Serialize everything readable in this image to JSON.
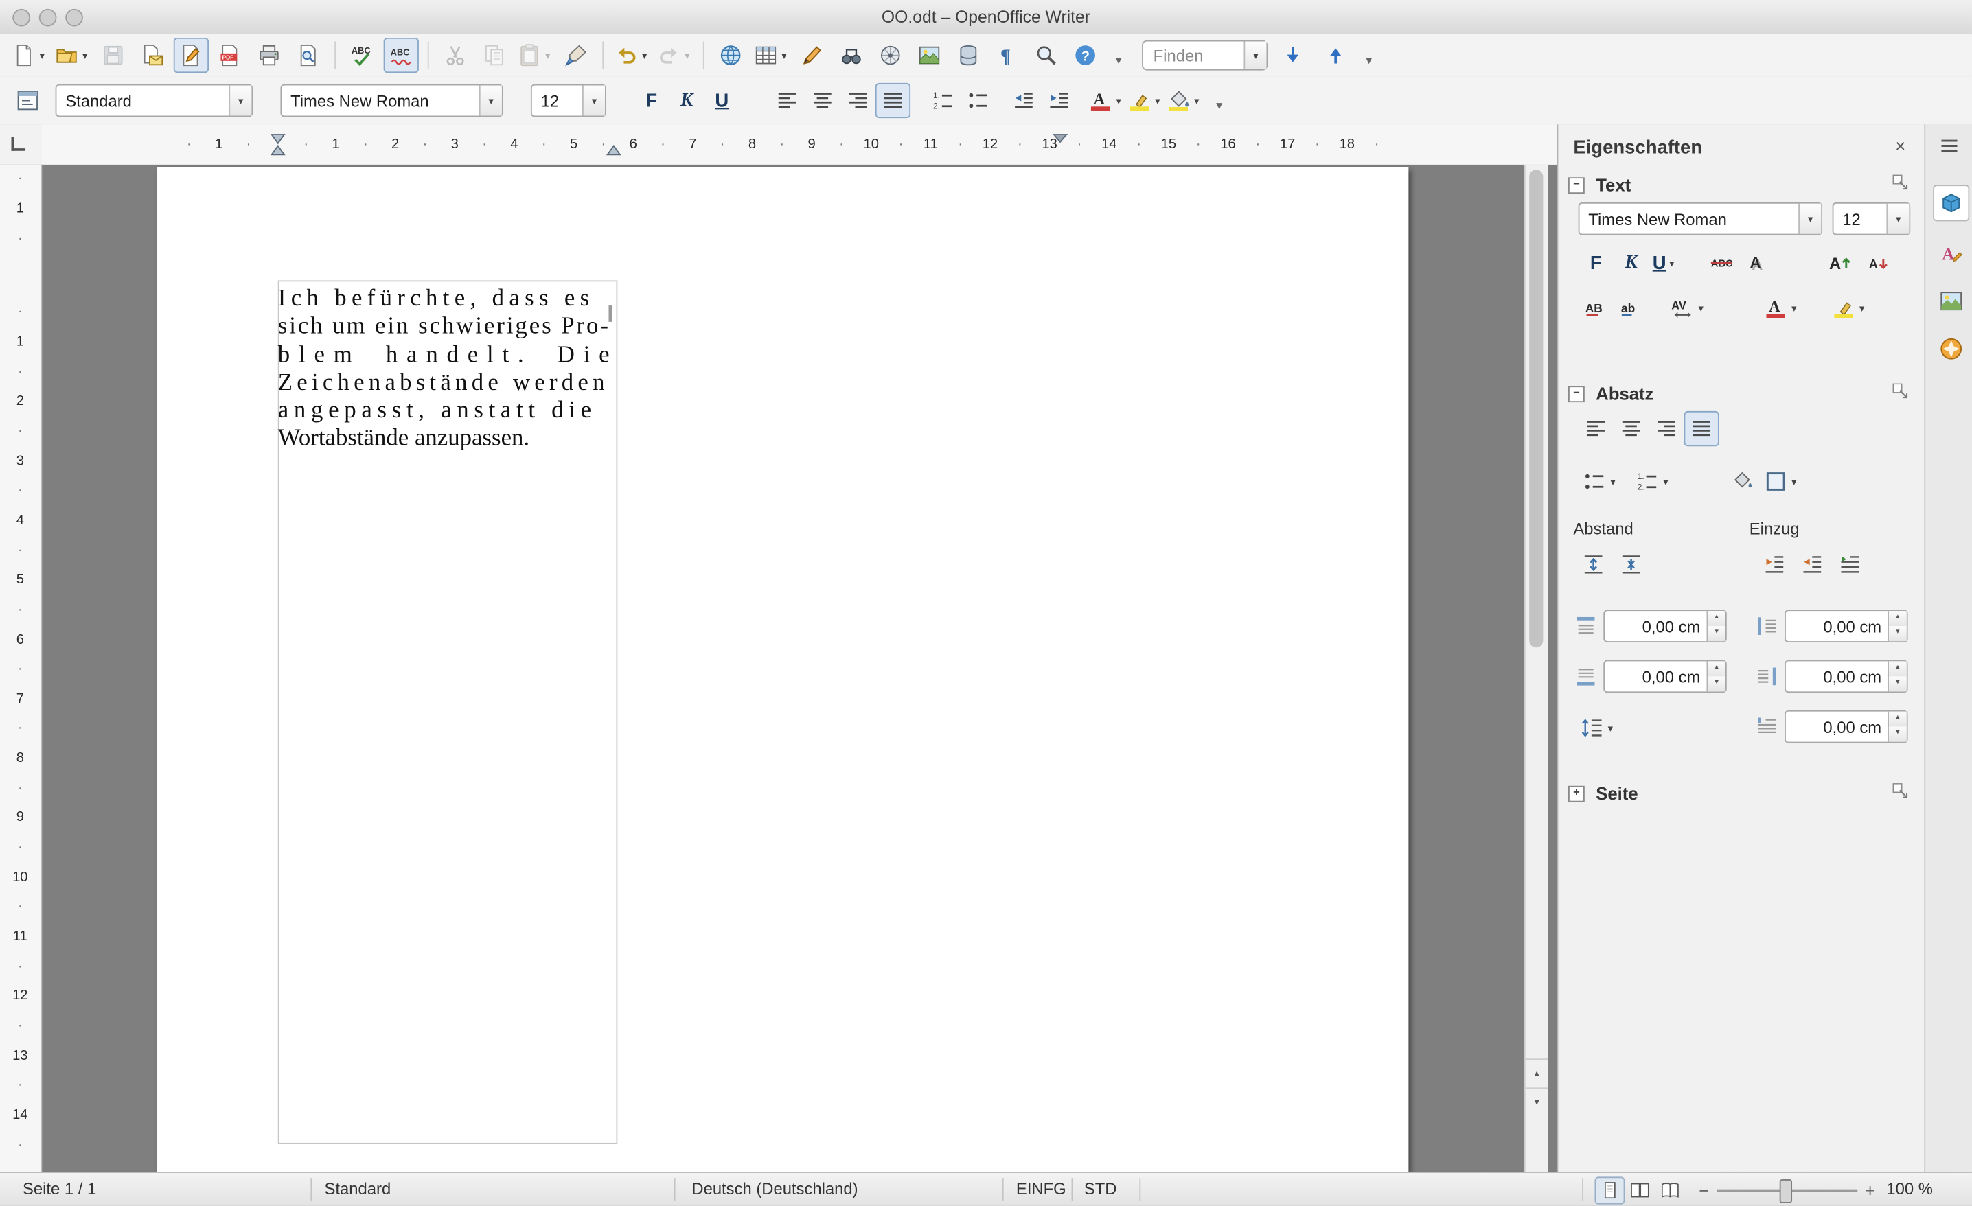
{
  "window": {
    "title": "OO.odt – OpenOffice Writer"
  },
  "standard_toolbar": {
    "find_placeholder": "Finden",
    "items": [
      {
        "icon": "new-document-icon",
        "dropdown": true
      },
      {
        "icon": "open-folder-icon",
        "dropdown": true
      },
      {
        "icon": "save-document-icon",
        "disabled": true
      },
      {
        "icon": "email-document-icon"
      },
      {
        "icon": "edit-file-icon",
        "active": true
      },
      {
        "icon": "export-pdf-icon"
      },
      {
        "icon": "print-icon"
      },
      {
        "icon": "page-preview-icon"
      },
      {
        "separator": true
      },
      {
        "icon": "spellcheck-icon"
      },
      {
        "icon": "auto-spellcheck-icon",
        "active": true
      },
      {
        "separator": true
      },
      {
        "icon": "cut-icon",
        "disabled": true
      },
      {
        "icon": "copy-icon",
        "disabled": true
      },
      {
        "icon": "paste-icon",
        "disabled": true,
        "dropdown": true
      },
      {
        "icon": "format-paintbrush-icon"
      },
      {
        "separator": true
      },
      {
        "icon": "undo-icon",
        "dropdown": true
      },
      {
        "icon": "redo-icon",
        "disabled": true,
        "dropdown": true
      },
      {
        "separator": true
      },
      {
        "icon": "hyperlink-icon"
      },
      {
        "icon": "table-icon",
        "dropdown": true
      },
      {
        "icon": "draw-functions-icon"
      },
      {
        "icon": "find-replace-icon"
      },
      {
        "icon": "navigator-icon"
      },
      {
        "icon": "gallery-icon"
      },
      {
        "icon": "data-sources-icon"
      },
      {
        "icon": "formatting-marks-icon"
      },
      {
        "icon": "zoom-icon"
      },
      {
        "icon": "help-icon"
      }
    ]
  },
  "formatting_toolbar": {
    "paragraph_style": "Standard",
    "font_name": "Times New Roman",
    "font_size": "12",
    "bold_label": "F",
    "italic_label": "K",
    "underline_label": "U"
  },
  "ruler": {
    "horizontal": {
      "margin_label": "1",
      "labels": [
        "1",
        "2",
        "3",
        "4",
        "5",
        "6",
        "7",
        "8",
        "9",
        "10",
        "11",
        "12",
        "13",
        "14",
        "15",
        "16",
        "17",
        "18"
      ]
    },
    "vertical": {
      "margin_label": "1",
      "labels": [
        "1",
        "2",
        "3",
        "4",
        "5",
        "6",
        "7",
        "8",
        "9",
        "10",
        "11",
        "12",
        "13",
        "14"
      ]
    }
  },
  "document": {
    "lines": [
      "Ich befürchte, dass es",
      "sich um ein schwieriges Pro-",
      "blem handelt. Die",
      "Zeichenabstände werden",
      "angepasst, anstatt die",
      "Wortabstände anzupassen."
    ]
  },
  "sidebar": {
    "title": "Eigenschaften",
    "text_section": {
      "label": "Text",
      "font_name": "Times New Roman",
      "font_size": "12",
      "bold_label": "F",
      "italic_label": "K",
      "underline_label": "U"
    },
    "paragraph_section": {
      "label": "Absatz",
      "spacing_label": "Abstand",
      "indent_label": "Einzug",
      "spacing_above": "0,00 cm",
      "spacing_below": "0,00 cm",
      "indent_before": "0,00 cm",
      "indent_after": "0,00 cm",
      "first_line_indent": "0,00 cm"
    },
    "page_section": {
      "label": "Seite"
    }
  },
  "status_bar": {
    "page_info": "Seite 1 / 1",
    "page_style": "Standard",
    "language": "Deutsch (Deutschland)",
    "insert_mode": "EINFG",
    "selection_mode": "STD",
    "zoom_value": "100 %"
  }
}
